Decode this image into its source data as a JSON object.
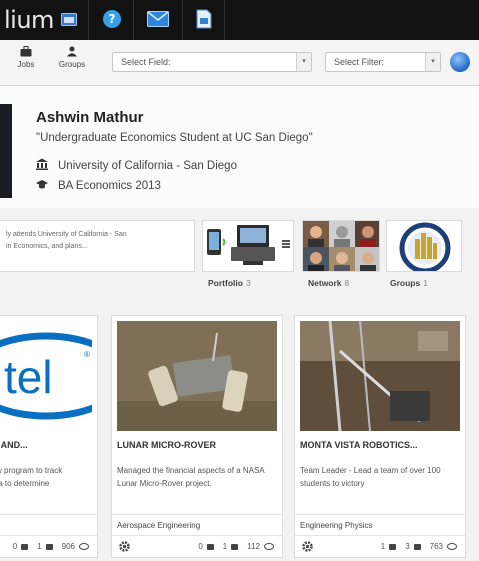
{
  "app": {
    "logo_text": "lium"
  },
  "topbar": {
    "icons": [
      "calendar-icon",
      "help-icon",
      "mail-icon",
      "document-icon"
    ]
  },
  "toolbar": {
    "jobs_label": "Jobs",
    "groups_label": "Groups",
    "field_select": "Select Field:",
    "filter_select": "Select Filter:"
  },
  "profile": {
    "name": "Ashwin Mathur",
    "tagline": "\"Undergraduate Economics Student at UC San Diego\"",
    "school": "University of California - San Diego",
    "degree": "BA Economics 2013"
  },
  "summary": {
    "line1": "ly attends University of California - San",
    "line2": "in Economics, and plans..."
  },
  "tiles": [
    {
      "label": "Portfolio",
      "count": "3"
    },
    {
      "label": "Network",
      "count": "8"
    },
    {
      "label": "Groups",
      "count": "1"
    }
  ],
  "cards": [
    {
      "title": "I AND...",
      "desc_line1": "w program to track",
      "desc_line2": "ta to determine",
      "category": "",
      "comments": "0",
      "likes": "1",
      "views": "906"
    },
    {
      "title": "LUNAR MICRO-ROVER",
      "desc": "Managed the financial aspects of a NASA Lunar Micro-Rover project.",
      "category": "Aerospace Engineering",
      "comments": "0",
      "likes": "1",
      "views": "112"
    },
    {
      "title": "MONTA VISTA ROBOTICS...",
      "desc": "Team Leader - Lead a team of over 100 students to victory",
      "category": "Engineering Physics",
      "comments": "1",
      "likes": "3",
      "views": "763"
    }
  ],
  "colors": {
    "topbar": "#121212",
    "intel_blue": "#0a6fc2",
    "accent_blue": "#2369c2"
  }
}
